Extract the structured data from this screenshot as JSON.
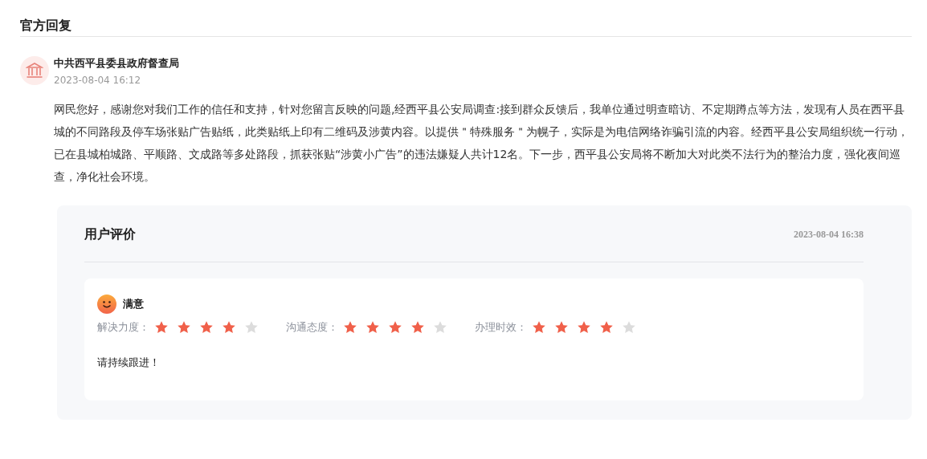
{
  "section_title": "官方回复",
  "reply": {
    "author": "中共西平县委县政府督查局",
    "time": "2023-08-04 16:12",
    "content": "网民您好，感谢您对我们工作的信任和支持，针对您留言反映的问题,经西平县公安局调查:接到群众反馈后，我单位通过明查暗访、不定期蹲点等方法，发现有人员在西平县城的不同路段及停车场张贴广告贴纸，此类贴纸上印有二维码及涉黄内容。以提供＂特殊服务＂为幌子，实际是为电信网络诈骗引流的内容。经西平县公安局组织统一行动，已在县城柏城路、平顺路、文成路等多处路段，抓获张贴“涉黄小广告”的违法嫌疑人共计12名。下一步，西平县公安局将不断加大对此类不法行为的整治力度，强化夜间巡查，净化社会环境。"
  },
  "evaluation": {
    "title": "用户评价",
    "time": "2023-08-04 16:38",
    "satisfaction": "满意",
    "ratings": [
      {
        "label": "解决力度：",
        "stars": 4
      },
      {
        "label": "沟通态度：",
        "stars": 4
      },
      {
        "label": "办理时效：",
        "stars": 4
      }
    ],
    "comment": "请持续跟进！"
  }
}
